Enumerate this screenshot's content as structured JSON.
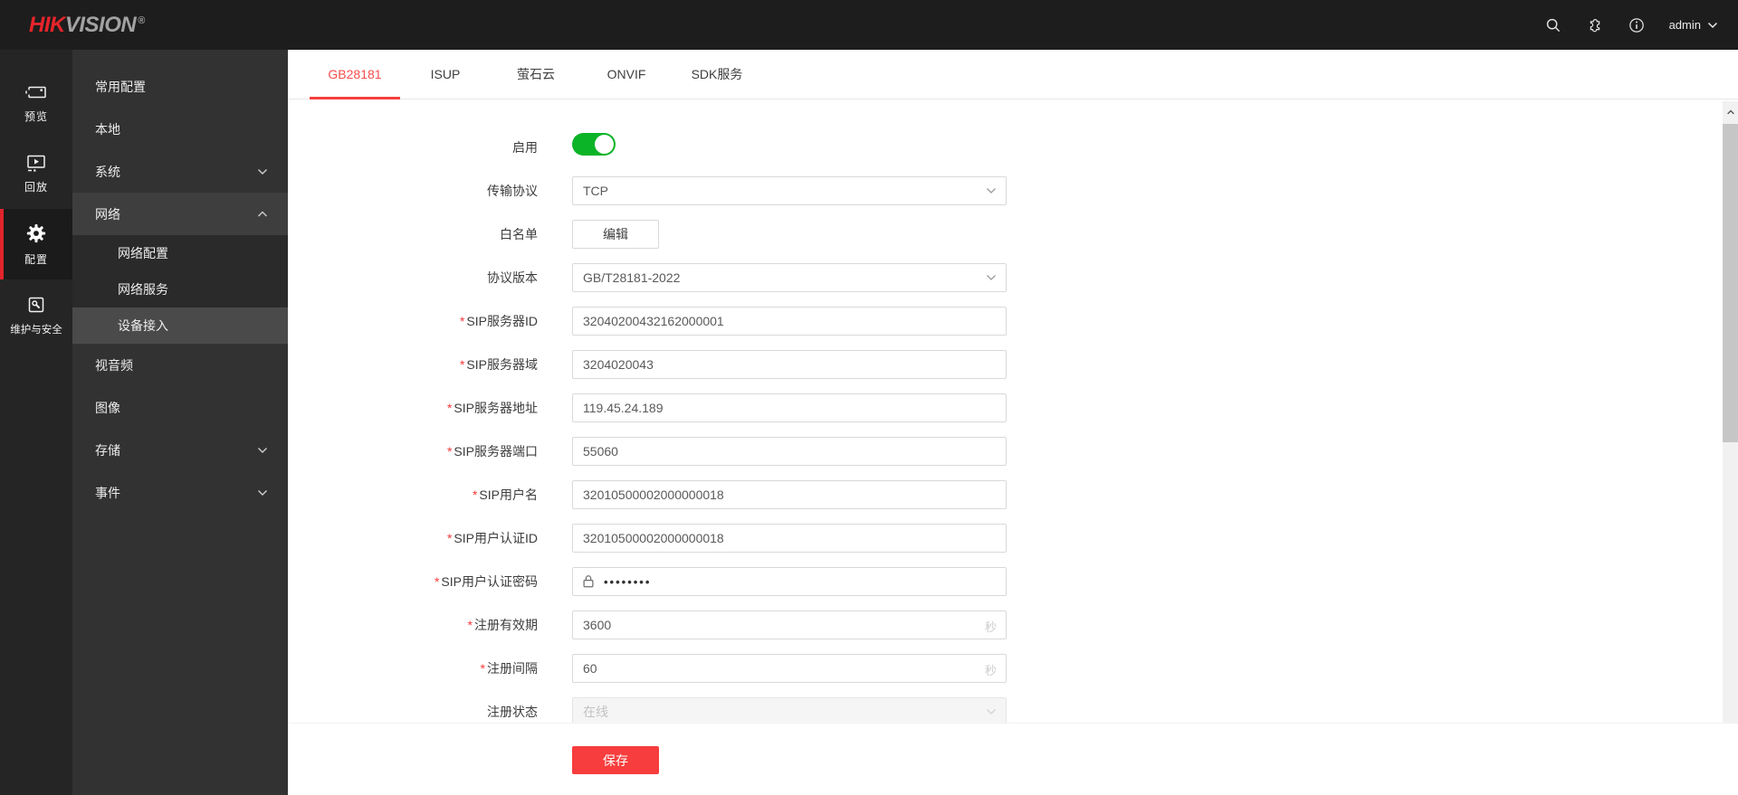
{
  "header": {
    "brand": {
      "part1": "HIK",
      "part2": "VISION",
      "registered": "®"
    },
    "icons": [
      "search-icon",
      "plugin-icon",
      "info-icon"
    ],
    "user_menu": {
      "username": "admin"
    }
  },
  "nav_rail": {
    "preview": "预览",
    "playback": "回放",
    "config": "配置",
    "maintenance": "维护与安全",
    "active_item": "配置"
  },
  "sidebar": {
    "common_config": "常用配置",
    "local": "本地",
    "system": "系统",
    "network": "网络",
    "network_config": "网络配置",
    "network_service": "网络服务",
    "device_access": "设备接入",
    "video_audio": "视音频",
    "image": "图像",
    "storage": "存储",
    "event": "事件",
    "selected_item": "设备接入"
  },
  "tabs": {
    "active": "GB28181",
    "items": [
      {
        "label": "GB28181"
      },
      {
        "label": "ISUP"
      },
      {
        "label": "萤石云"
      },
      {
        "label": "ONVIF"
      },
      {
        "label": "SDK服务"
      }
    ]
  },
  "form": {
    "required_marker": "*",
    "enable": {
      "label": "启用",
      "state": "on"
    },
    "transport_protocol": {
      "label": "传输协议",
      "value": "TCP"
    },
    "whitelist": {
      "label": "白名单",
      "button": "编辑"
    },
    "protocol_version": {
      "label": "协议版本",
      "value": "GB/T28181-2022"
    },
    "sip_server_id": {
      "label": "SIP服务器ID",
      "value": "32040200432162000001"
    },
    "sip_server_domain": {
      "label": "SIP服务器域",
      "value": "3204020043"
    },
    "sip_server_address": {
      "label": "SIP服务器地址",
      "value": "119.45.24.189"
    },
    "sip_server_port": {
      "label": "SIP服务器端口",
      "value": "55060"
    },
    "sip_username": {
      "label": "SIP用户名",
      "value": "32010500002000000018"
    },
    "sip_user_auth_id": {
      "label": "SIP用户认证ID",
      "value": "32010500002000000018"
    },
    "sip_user_auth_password": {
      "label": "SIP用户认证密码",
      "value": "••••••••"
    },
    "register_validity": {
      "label": "注册有效期",
      "value": "3600",
      "unit": "秒"
    },
    "register_interval": {
      "label": "注册间隔",
      "value": "60",
      "unit": "秒"
    },
    "register_status": {
      "label": "注册状态",
      "value": "在线",
      "disabled": true
    },
    "save_button": "保存"
  },
  "colors": {
    "brand_red": "#e6242b",
    "accent_red": "#f64c4c",
    "save_red": "#f73d3d",
    "toggle_green": "#0bb327",
    "topbar_bg": "#1d1d1d",
    "rail_bg": "#252525",
    "menu_bg": "#323232"
  }
}
